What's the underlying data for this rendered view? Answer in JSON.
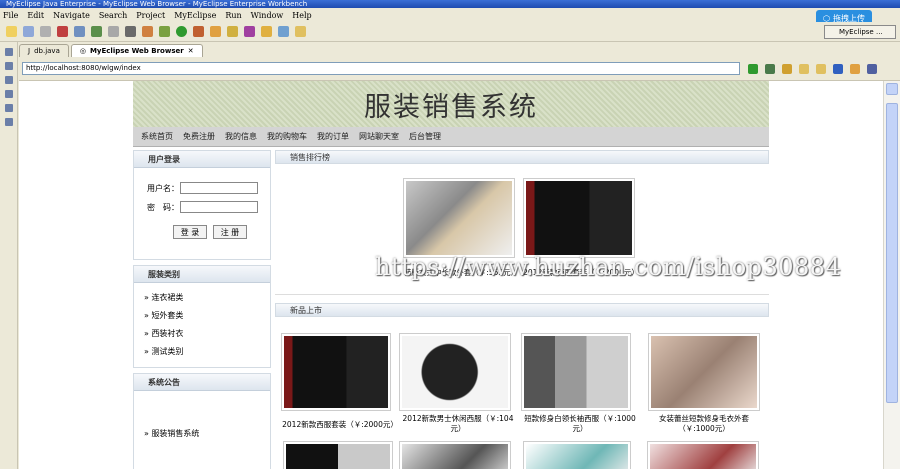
{
  "window": {
    "title": "MyEclipse Java Enterprise - MyEclipse Web Browser - MyEclipse Enterprise Workbench"
  },
  "menu": [
    "File",
    "Edit",
    "Navigate",
    "Search",
    "Project",
    "MyEclipse",
    "Run",
    "Window",
    "Help"
  ],
  "upload_button": "拖拽上传",
  "perspective": "MyEclipse ...",
  "tabs": [
    {
      "label": "db.java",
      "active": false
    },
    {
      "label": "MyEclipse Web Browser",
      "active": true
    }
  ],
  "address": {
    "url": "http://localhost:8080/wlgw/index"
  },
  "site": {
    "banner_title": "服装销售系统",
    "nav": [
      "系统首页",
      "免费注册",
      "我的信息",
      "我的购物车",
      "我的订单",
      "网站聊天室",
      "后台管理"
    ],
    "login": {
      "title": "用户登录",
      "username_label": "用户名：",
      "password_label": "密　码：",
      "login_button": "登 录",
      "register_button": "注 册"
    },
    "categories": {
      "title": "服装类别",
      "items": [
        "连衣裙类",
        "短外套类",
        "西装衬衣",
        "测试类别"
      ]
    },
    "notice": {
      "title": "系统公告",
      "items": [
        "服装销售系统"
      ]
    },
    "hot": {
      "title": "销售排行榜",
      "products": [
        {
          "name": "韩版女式中长款外套（￥:555元）"
        },
        {
          "name": "2012新款西服套装（￥:2000元）"
        }
      ]
    },
    "new": {
      "title": "新品上市",
      "products": [
        {
          "name": "2012新款西服套装（￥:2000元）"
        },
        {
          "name": "2012新款男士休闲西服（￥:104元）"
        },
        {
          "name": "短款修身白领长袖西服（￥:1000元）"
        },
        {
          "name": "女装蕾丝短款修身毛衣外套（￥:1000元）"
        }
      ]
    }
  },
  "watermark": "https://www.huzhan.com/ishop30884",
  "colors": {
    "titlebar": "#1e4bb0",
    "upload": "#2a8fe0",
    "nav": "#d4d4d4"
  }
}
